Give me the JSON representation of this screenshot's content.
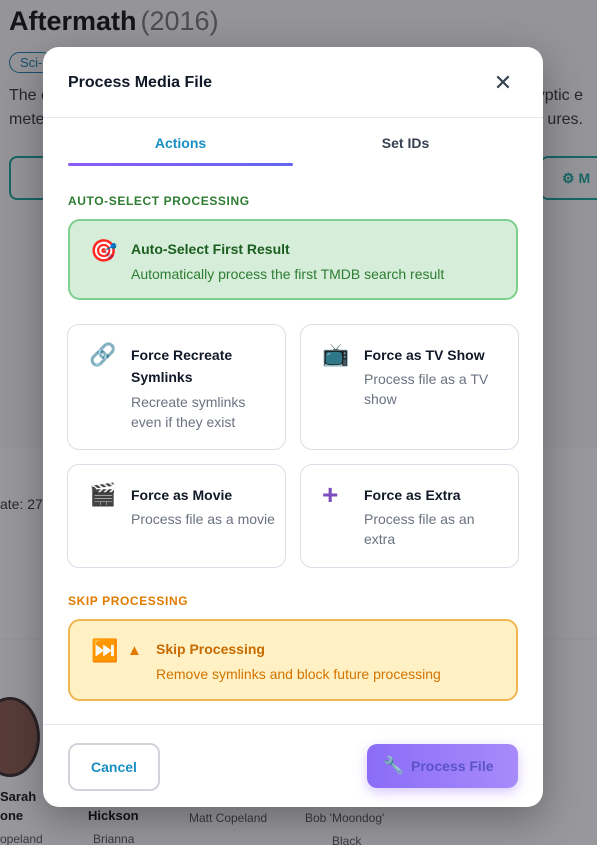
{
  "background": {
    "title": "Aftermath",
    "year": "(2016)",
    "genre_badge": "Sci-",
    "overview_left_1": "The c",
    "overview_right_1": "alyptic e",
    "overview_left_2": "mete",
    "overview_right_2": "ures.",
    "right_button_label": "M",
    "release_date_fragment": "ate: 27/",
    "cast": [
      {
        "name": "Sarah",
        "name2": "one",
        "role": "opeland"
      },
      {
        "name": "Hickson",
        "role": "Brianna"
      },
      {
        "role": "Matt Copeland"
      },
      {
        "role": "Bob 'Moondog'",
        "role2": "Black"
      }
    ]
  },
  "modal": {
    "title": "Process Media File",
    "close_icon": "close-icon",
    "tabs": [
      {
        "label": "Actions",
        "active": true
      },
      {
        "label": "Set IDs",
        "active": false
      }
    ],
    "auto_section_label": "AUTO-SELECT PROCESSING",
    "auto_card": {
      "icon": "target-icon",
      "title": "Auto-Select First Result",
      "description": "Automatically process the first TMDB search result"
    },
    "options": [
      {
        "icon": "link-icon",
        "title": "Force Recreate Symlinks",
        "description": "Recreate symlinks even if they exist"
      },
      {
        "icon": "tv-icon",
        "title": "Force as TV Show",
        "description": "Process file as a TV show"
      },
      {
        "icon": "clapper-icon",
        "title": "Force as Movie",
        "description": "Process file as a movie"
      },
      {
        "icon": "plus-icon",
        "title": "Force as Extra",
        "description": "Process file as an extra"
      }
    ],
    "skip_section_label": "SKIP PROCESSING",
    "skip_card": {
      "icon": "skip-forward-icon",
      "warning_icon": "warning-icon",
      "title": "Skip Processing",
      "description": "Remove symlinks and block future processing"
    },
    "footer": {
      "cancel_label": "Cancel",
      "process_label": "Process File",
      "process_icon": "wrench-icon"
    }
  },
  "colors": {
    "accent_blue": "#1a8fc4",
    "tab_underline": "#8b5cf6",
    "auto_green_bg": "#d5edd9",
    "auto_green_border": "#7fcf8c",
    "skip_orange_bg": "#fff1c4",
    "skip_orange_border": "#f0b650",
    "process_button": "#a78bfa"
  }
}
